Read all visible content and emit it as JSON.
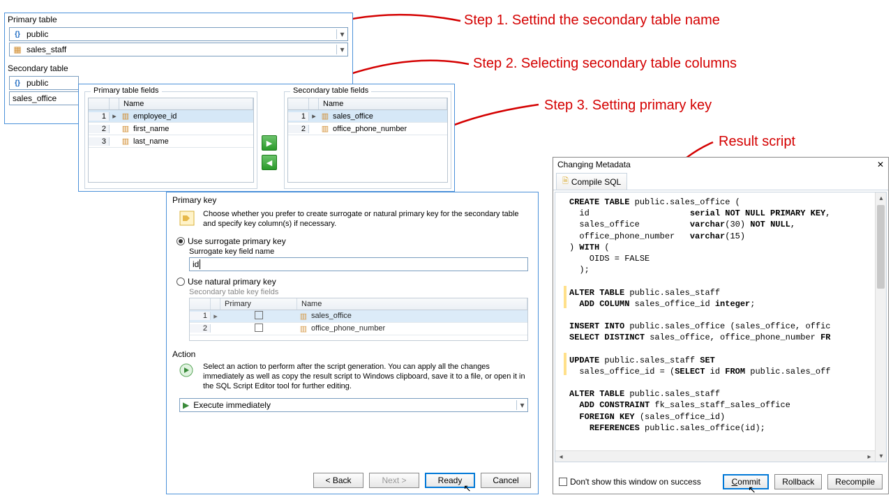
{
  "callouts": {
    "step1": "Step 1. Settind the secondary table name",
    "step2": "Step 2. Selecting secondary table columns",
    "step3": "Step 3. Setting primary key",
    "result": "Result script"
  },
  "topPanel": {
    "primaryLabel": "Primary table",
    "schema": "public",
    "table": "sales_staff",
    "secondaryLabel": "Secondary table",
    "secSchema": "public",
    "secTable": "sales_office"
  },
  "fieldsPanel": {
    "primaryFieldsLabel": "Primary table fields",
    "secondaryFieldsLabel": "Secondary table fields",
    "headerName": "Name",
    "primaryFields": [
      "employee_id",
      "first_name",
      "last_name"
    ],
    "secondaryFields": [
      "sales_office",
      "office_phone_number"
    ]
  },
  "pkPanel": {
    "title": "Primary key",
    "introText": "Choose whether you prefer to create surrogate or natural primary key for the secondary table and specify key column(s) if necessary.",
    "surrogateRadio": "Use surrogate primary key",
    "surrogateFieldLabel": "Surrogate key field name",
    "surrogateValue": "id",
    "naturalRadio": "Use natural primary key",
    "secKeyFieldsLabel": "Secondary table key fields",
    "colPrimary": "Primary",
    "colName": "Name",
    "keyRows": [
      "sales_office",
      "office_phone_number"
    ],
    "actionTitle": "Action",
    "actionText": "Select an action to perform after the script generation. You can apply all the changes immediately as well as copy the result script to Windows clipboard, save it to a file, or open it in the SQL Script Editor tool for further editing.",
    "actionSelect": "Execute immediately",
    "buttons": {
      "back": "< Back",
      "next": "Next >",
      "ready": "Ready",
      "cancel": "Cancel"
    }
  },
  "resultModal": {
    "title": "Changing Metadata",
    "tab": "Compile SQL",
    "sql": "CREATE TABLE public.sales_office (\n  id                    serial NOT NULL PRIMARY KEY,\n  sales_office          varchar(30) NOT NULL,\n  office_phone_number   varchar(15)\n) WITH (\n    OIDS = FALSE\n  );\n\nALTER TABLE public.sales_staff\n  ADD COLUMN sales_office_id integer;\n\nINSERT INTO public.sales_office (sales_office, offic\nSELECT DISTINCT sales_office, office_phone_number FR\n\nUPDATE public.sales_staff SET\n  sales_office_id = (SELECT id FROM public.sales_off\n\nALTER TABLE public.sales_staff\n  ADD CONSTRAINT fk_sales_staff_sales_office\n  FOREIGN KEY (sales_office_id)\n    REFERENCES public.sales_office(id);",
    "dontShow": "Don't show this window on success",
    "commit": "Commit",
    "rollback": "Rollback",
    "recompile": "Recompile"
  }
}
